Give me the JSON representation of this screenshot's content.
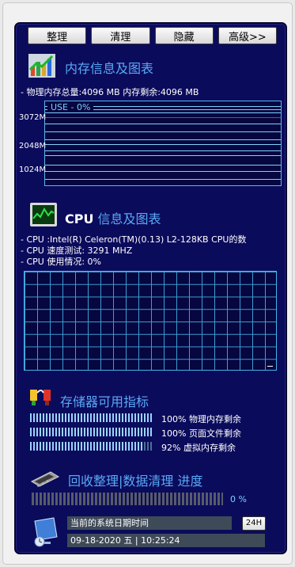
{
  "toolbar": {
    "buttons": [
      "整理",
      "清理",
      "隐藏",
      "高级>>"
    ]
  },
  "memory": {
    "title": "内存信息及图表",
    "info": "- 物理内存总量:4096 MB  内存剩余:4096 MB",
    "use_label": "USE - 0%",
    "axis_labels": [
      "3072M",
      "2048M",
      "1024M"
    ]
  },
  "cpu": {
    "title_bold": "CPU",
    "title_rest": " 信息及图表",
    "line1": "- CPU :Intel(R) Celeron(TM)(0.13) L2-128KB CPU的数",
    "line2": "- CPU 速度测试: 3291 MHZ",
    "line3": "- CPU 使用情况:  0%"
  },
  "storage": {
    "title": "存储器可用指标",
    "items": [
      {
        "percent": 100,
        "label": "100% 物理内存剩余"
      },
      {
        "percent": 100,
        "label": "100% 页面文件剩余"
      },
      {
        "percent": 92,
        "label": "92% 虚拟内存剩余"
      }
    ]
  },
  "recycle": {
    "title": "回收整理|数据清理 进度",
    "progress_text": "0 %",
    "progress": 0
  },
  "clock": {
    "label": "当前的系统日期时间",
    "button": "24H",
    "value": "09-18-2020  五 | 10:25:24"
  },
  "colors": {
    "panel_bg": "#0b0b5c",
    "title_blue": "#59a9f4",
    "use_line_red": "#d42a2a",
    "grid_cyan": "#3a9ed0"
  }
}
